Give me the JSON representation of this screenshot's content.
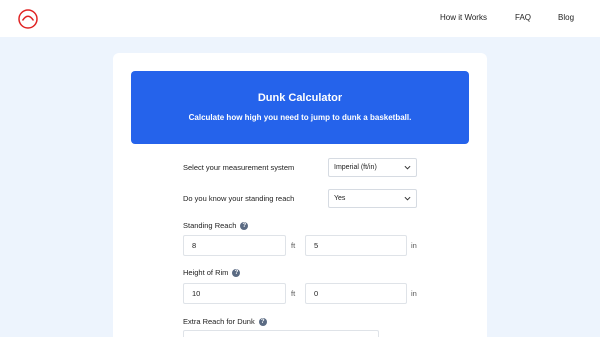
{
  "nav": {
    "how_it_works": "How it Works",
    "faq": "FAQ",
    "blog": "Blog"
  },
  "banner": {
    "title": "Dunk Calculator",
    "subtitle": "Calculate how high you need to jump to dunk a basketball."
  },
  "form": {
    "measurement": {
      "label": "Select your measurement system",
      "value": "Imperial (ft/in)"
    },
    "know_reach": {
      "label": "Do you know your standing reach",
      "value": "Yes"
    },
    "standing_reach": {
      "label": "Standing Reach",
      "help": "?",
      "feet": "8",
      "feet_unit": "ft",
      "inches": "5",
      "inches_unit": "in"
    },
    "rim_height": {
      "label": "Height of Rim",
      "help": "?",
      "feet": "10",
      "feet_unit": "ft",
      "inches": "0",
      "inches_unit": "in"
    },
    "extra_reach": {
      "label": "Extra Reach for Dunk",
      "help": "?"
    }
  },
  "colors": {
    "accent": "#2563eb",
    "logo": "#e02424",
    "background": "#edf4fd",
    "help_badge": "#5b6b83"
  },
  "icons": {
    "logo": "arc-logo-icon",
    "select_arrow": "chevron-down-icon",
    "help": "question-icon"
  }
}
